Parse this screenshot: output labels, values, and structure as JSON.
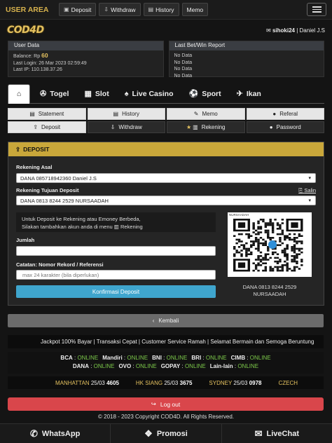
{
  "topbar": {
    "title": "USER AREA",
    "buttons": [
      {
        "label": "Deposit",
        "icon": "deposit-icon"
      },
      {
        "label": "Withdraw",
        "icon": "withdraw-icon"
      },
      {
        "label": "History",
        "icon": "history-icon"
      },
      {
        "label": "Memo",
        "icon": ""
      }
    ]
  },
  "brand": {
    "logo": "COD4D",
    "username": "sihoki24",
    "fullname": "Daniel J.S"
  },
  "user_data": {
    "title": "User Data",
    "balance_label": "Balance: Rp",
    "balance_value": "60",
    "last_login": "Last Login: 26 Mar 2023 02:59:49",
    "last_ip": "Last IP: 110.138.37.26"
  },
  "last_bet": {
    "title": "Last Bet/Win Report",
    "rows": [
      "No Data",
      "No Data",
      "No Data",
      "No Data"
    ]
  },
  "main_tabs": {
    "home_icon": "home-icon",
    "items": [
      {
        "label": "Togel",
        "icon": "togel-icon"
      },
      {
        "label": "Slot",
        "icon": "slot-icon"
      },
      {
        "label": "Live Casino",
        "icon": "casino-icon"
      },
      {
        "label": "Sport",
        "icon": "sport-icon"
      },
      {
        "label": "Ikan",
        "icon": "fish-icon"
      }
    ]
  },
  "sub_nav": [
    {
      "label": "Statement"
    },
    {
      "label": "History"
    },
    {
      "label": "Memo"
    },
    {
      "label": "Referal"
    },
    {
      "label": "Deposit"
    },
    {
      "label": "Withdraw"
    },
    {
      "label": "Rekening"
    },
    {
      "label": "Password"
    }
  ],
  "deposit": {
    "header": "DEPOSIT",
    "rekening_asal_label": "Rekening Asal",
    "rekening_asal_value": "DANA 085718942360 Daniel J.S",
    "rekening_tujuan_label": "Rekening Tujuan Deposit",
    "salin": "Salin",
    "rekening_tujuan_value": "DANA 0813 8244 2529 NURSAADAH",
    "notice_line1": "Untuk Deposit ke Rekening atau Emoney Berbeda,",
    "notice_line2": "Silakan tambahkan akun anda di menu",
    "notice_link": "Rekening",
    "jumlah_label": "Jumlah",
    "jumlah_value": "",
    "catatan_label": "Catatan: Nomor Rekord / Referensi",
    "catatan_placeholder": "max 24 karakter (bila diperlukan)",
    "submit": "Konfirmasi Deposit",
    "qr_name": "NURSAADAH",
    "qr_caption_line1": "DANA 0813 8244 2529",
    "qr_caption_line2": "NURSAADAH"
  },
  "back_button": "Kembali",
  "marquee": "Jackpot 100% Bayar | Transaksi Cepat | Customer Service Ramah | Selamat Bermain dan Semoga Beruntung",
  "banks_row1": [
    {
      "name": "BCA",
      "status": "ONLINE"
    },
    {
      "name": "Mandiri",
      "status": "ONLINE"
    },
    {
      "name": "BNI",
      "status": "ONLINE"
    },
    {
      "name": "BRI",
      "status": "ONLINE"
    },
    {
      "name": "CIMB",
      "status": "ONLINE"
    }
  ],
  "banks_row2": [
    {
      "name": "DANA",
      "status": "ONLINE"
    },
    {
      "name": "OVO",
      "status": "ONLINE"
    },
    {
      "name": "GOPAY",
      "status": "ONLINE"
    },
    {
      "name": "Lain-lain",
      "status": "ONLINE"
    }
  ],
  "lottery": [
    {
      "market": "MANHATTAN",
      "date": "25/03",
      "number": "4605"
    },
    {
      "market": "HK SIANG",
      "date": "25/03",
      "number": "3675"
    },
    {
      "market": "SYDNEY",
      "date": "25/03",
      "number": "0978"
    },
    {
      "market": "CZECH",
      "date": "",
      "number": ""
    }
  ],
  "logout": "Log out",
  "copyright": "© 2018 - 2023 Copyright COD4D. All Rights Reserved.",
  "bottom_bar": [
    {
      "label": "WhatsApp",
      "icon": "whatsapp-icon"
    },
    {
      "label": "Promosi",
      "icon": "gift-icon"
    },
    {
      "label": "LiveChat",
      "icon": "chat-icon"
    }
  ],
  "colors": {
    "accent_gold": "#c9a73a",
    "online_green": "#7cc94a",
    "button_blue": "#3fa5cd",
    "logout_red": "#d9464b"
  }
}
